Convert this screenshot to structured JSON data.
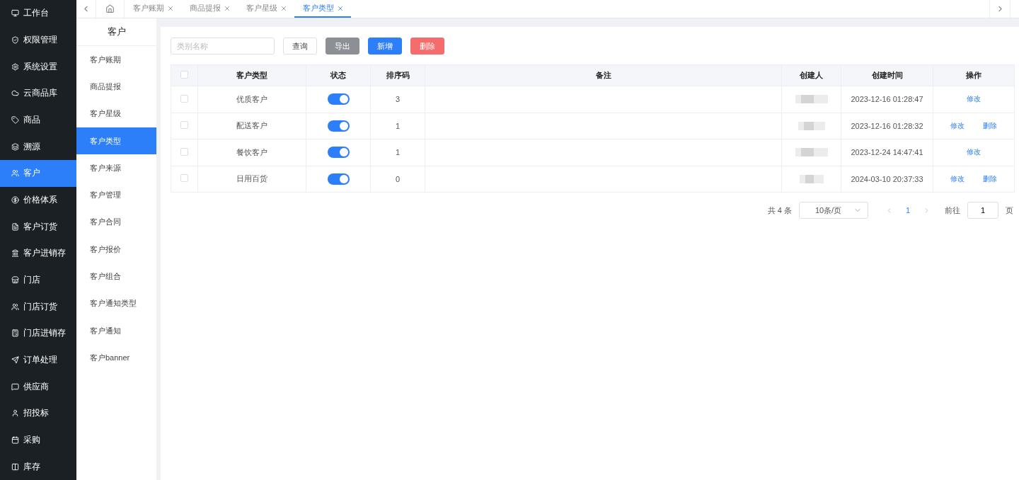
{
  "sidebar": {
    "items": [
      {
        "label": "工作台",
        "selected": false
      },
      {
        "label": "权限管理",
        "selected": false
      },
      {
        "label": "系统设置",
        "selected": false
      },
      {
        "label": "云商品库",
        "selected": false
      },
      {
        "label": "商品",
        "selected": false
      },
      {
        "label": "溯源",
        "selected": false
      },
      {
        "label": "客户",
        "selected": true
      },
      {
        "label": "价格体系",
        "selected": false
      },
      {
        "label": "客户订货",
        "selected": false
      },
      {
        "label": "客户进销存",
        "selected": false
      },
      {
        "label": "门店",
        "selected": false
      },
      {
        "label": "门店订货",
        "selected": false
      },
      {
        "label": "门店进销存",
        "selected": false
      },
      {
        "label": "订单处理",
        "selected": false
      },
      {
        "label": "供应商",
        "selected": false
      },
      {
        "label": "招投标",
        "selected": false
      },
      {
        "label": "采购",
        "selected": false
      },
      {
        "label": "库存",
        "selected": false
      }
    ]
  },
  "tabs": [
    {
      "label": "客户账期",
      "selected": false
    },
    {
      "label": "商品提报",
      "selected": false
    },
    {
      "label": "客户星级",
      "selected": false
    },
    {
      "label": "客户类型",
      "selected": true
    }
  ],
  "submenu": {
    "title": "客户",
    "items": [
      {
        "label": "客户账期",
        "selected": false
      },
      {
        "label": "商品提报",
        "selected": false
      },
      {
        "label": "客户星级",
        "selected": false
      },
      {
        "label": "客户类型",
        "selected": true
      },
      {
        "label": "客户来源",
        "selected": false
      },
      {
        "label": "客户管理",
        "selected": false
      },
      {
        "label": "客户合同",
        "selected": false
      },
      {
        "label": "客户报价",
        "selected": false
      },
      {
        "label": "客户组合",
        "selected": false
      },
      {
        "label": "客户通知类型",
        "selected": false
      },
      {
        "label": "客户通知",
        "selected": false
      },
      {
        "label": "客户banner",
        "selected": false
      }
    ]
  },
  "toolbar": {
    "search": {
      "placeholder": "类别名称"
    },
    "buttons": [
      {
        "label": "查询",
        "kind": "plain"
      },
      {
        "label": "导出",
        "kind": "gray"
      },
      {
        "label": "新增",
        "kind": "primary"
      },
      {
        "label": "删除",
        "kind": "danger"
      }
    ]
  },
  "table": {
    "select_all": {
      "checked": false
    },
    "columns": [
      "客户类型",
      "状态",
      "排序码",
      "备注",
      "创建人",
      "创建时间",
      "操作"
    ],
    "rows": [
      {
        "checked": false,
        "type": "优质客户",
        "enabled": true,
        "sort": "3",
        "created": "2023-12-16 01:28:47",
        "actions": [
          "修改"
        ]
      },
      {
        "checked": false,
        "type": "配送客户",
        "enabled": true,
        "sort": "1",
        "created": "2023-12-16 01:28:32",
        "actions": [
          "修改",
          "删除"
        ]
      },
      {
        "checked": false,
        "type": "餐饮客户",
        "enabled": true,
        "sort": "1",
        "created": "2023-12-24 14:47:41",
        "actions": [
          "修改"
        ]
      },
      {
        "checked": false,
        "type": "日用百货",
        "enabled": true,
        "sort": "0",
        "created": "2024-03-10 20:37:33",
        "actions": [
          "修改",
          "删除"
        ]
      }
    ]
  },
  "pagination": {
    "total": "共 4 条",
    "page_size": "10条/页",
    "pages": [
      {
        "label": "1",
        "selected": true
      }
    ],
    "goto_label": "前往",
    "goto_value": "1",
    "page_suffix": "页"
  }
}
